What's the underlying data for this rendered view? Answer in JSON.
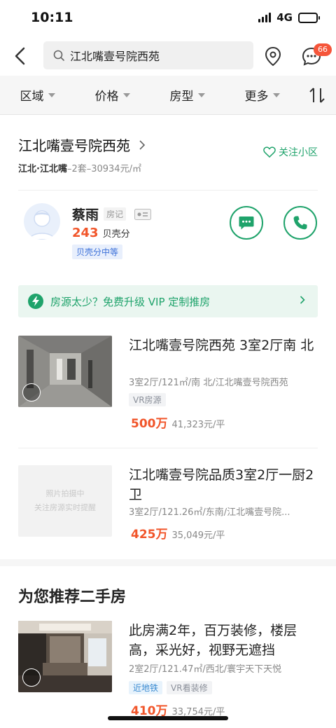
{
  "status": {
    "time": "10:11",
    "network": "4G"
  },
  "search": {
    "query": "江北嘴壹号院西苑"
  },
  "header": {
    "message_badge": "66"
  },
  "filters": [
    "区域",
    "价格",
    "房型",
    "更多"
  ],
  "community": {
    "name": "江北嘴壹号院西苑",
    "district": "江北·江北嘴",
    "summary": "–2套–30934元/㎡",
    "follow_label": "关注小区"
  },
  "agent": {
    "name": "蔡雨",
    "role_tag": "房记",
    "score": "243",
    "score_unit": "贝壳分",
    "level": "贝壳分中等"
  },
  "vip_banner": {
    "text": "房源太少？免费升级 VIP 定制推房"
  },
  "listings": [
    {
      "title": "江北嘴壹号院西苑 3室2厅南 北",
      "info": "3室2厅/121㎡/南 北/江北嘴壹号院西苑",
      "tags": [
        "VR房源"
      ],
      "price": "500万",
      "unit_price": "41,323元/平"
    },
    {
      "title": "江北嘴壹号院品质3室2厅一厨2卫",
      "info": "3室2厅/121.26㎡/东南/江北嘴壹号院...",
      "placeholder_line1": "照片拍摄中",
      "placeholder_line2": "关注房源实时提醒",
      "price": "425万",
      "unit_price": "35,049元/平"
    }
  ],
  "recommend": {
    "title": "为您推荐二手房",
    "items": [
      {
        "title": "此房满2年，百万装修，楼层高，采光好，视野无遮挡",
        "info": "2室2厅/121.47㎡/西北/寰宇天下天悦",
        "tags": [
          "近地铁",
          "VR看装修"
        ],
        "price": "410万",
        "unit_price": "33,754元/平"
      }
    ]
  },
  "colors": {
    "accent": "#1fa36b",
    "price": "#f1552a",
    "badge": "#f5553a"
  }
}
